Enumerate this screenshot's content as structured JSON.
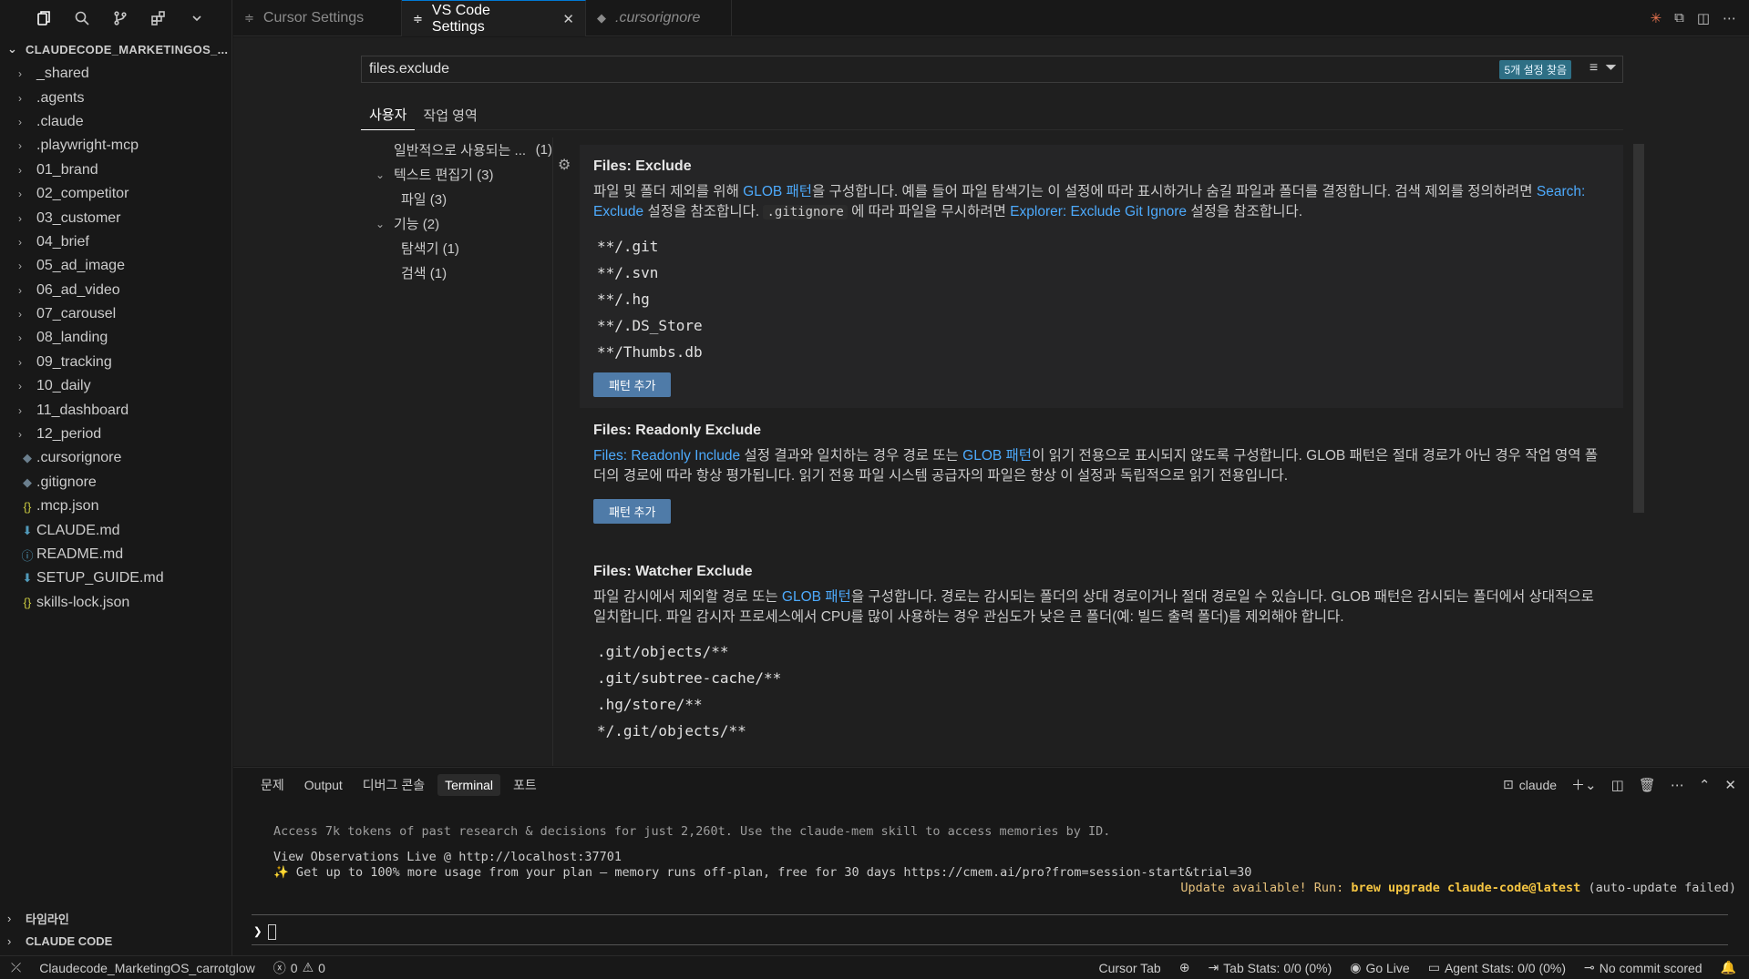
{
  "explorer": {
    "title": "CLAUDECODE_MARKETINGOS_...",
    "items": [
      {
        "label": "_shared",
        "type": "folder"
      },
      {
        "label": ".agents",
        "type": "folder"
      },
      {
        "label": ".claude",
        "type": "folder"
      },
      {
        "label": ".playwright-mcp",
        "type": "folder"
      },
      {
        "label": "01_brand",
        "type": "folder"
      },
      {
        "label": "02_competitor",
        "type": "folder"
      },
      {
        "label": "03_customer",
        "type": "folder"
      },
      {
        "label": "04_brief",
        "type": "folder"
      },
      {
        "label": "05_ad_image",
        "type": "folder"
      },
      {
        "label": "06_ad_video",
        "type": "folder"
      },
      {
        "label": "07_carousel",
        "type": "folder"
      },
      {
        "label": "08_landing",
        "type": "folder"
      },
      {
        "label": "09_tracking",
        "type": "folder"
      },
      {
        "label": "10_daily",
        "type": "folder"
      },
      {
        "label": "11_dashboard",
        "type": "folder"
      },
      {
        "label": "12_period",
        "type": "folder"
      },
      {
        "label": ".cursorignore",
        "type": "file",
        "icon": "diamond"
      },
      {
        "label": ".gitignore",
        "type": "file",
        "icon": "diamond"
      },
      {
        "label": ".mcp.json",
        "type": "file",
        "icon": "braces"
      },
      {
        "label": "CLAUDE.md",
        "type": "file",
        "icon": "markdown"
      },
      {
        "label": "README.md",
        "type": "file",
        "icon": "info"
      },
      {
        "label": "SETUP_GUIDE.md",
        "type": "file",
        "icon": "markdown"
      },
      {
        "label": "skills-lock.json",
        "type": "file",
        "icon": "braces"
      }
    ],
    "timeline_label": "타임라인",
    "claude_code_label": "CLAUDE CODE"
  },
  "tabs": [
    {
      "label": "Cursor Settings",
      "active": false,
      "icon": "settings-tab-icon"
    },
    {
      "label": "VS Code Settings",
      "active": true,
      "icon": "settings-tab-icon"
    },
    {
      "label": ".cursorignore",
      "active": false,
      "icon": "file-icon"
    }
  ],
  "settings": {
    "search_value": "files.exclude",
    "result_count": "5개 설정 찾음",
    "scope_tabs": [
      "사용자",
      "작업 영역"
    ],
    "toc": [
      {
        "label": "일반적으로 사용되는 ...",
        "count": "(1)"
      },
      {
        "label": "텍스트 편집기 (3)"
      },
      {
        "label": "파일 (3)"
      },
      {
        "label": "기능 (2)"
      },
      {
        "label": "탐색기 (1)"
      },
      {
        "label": "검색 (1)"
      }
    ],
    "exclude": {
      "title": "Files: Exclude",
      "desc_1": "파일 및 폴더 제외를 위해 ",
      "desc_link_1": "GLOB 패턴",
      "desc_2": "을 구성합니다. 예를 들어 파일 탐색기는 이 설정에 따라 표시하거나 숨길 파일과 폴더를 결정합니다. 검색 제외를 정의하려면 ",
      "desc_link_2": "Search: Exclude",
      "desc_3": " 설정을 참조합니다. ",
      "desc_code": ".gitignore",
      "desc_4": " 에 따라 파일을 무시하려면 ",
      "desc_link_3": "Explorer: Exclude Git Ignore",
      "desc_5": " 설정을 참조합니다.",
      "patterns": [
        "**/.git",
        "**/.svn",
        "**/.hg",
        "**/.DS_Store",
        "**/Thumbs.db"
      ],
      "add_label": "패턴 추가"
    },
    "readonly": {
      "title": "Files: Readonly Exclude",
      "desc_link_1": "Files: Readonly Include",
      "desc_1": " 설정 결과와 일치하는 경우 경로 또는 ",
      "desc_link_2": "GLOB 패턴",
      "desc_2": "이 읽기 전용으로 표시되지 않도록 구성합니다. GLOB 패턴은 절대 경로가 아닌 경우 작업 영역 폴더의 경로에 따라 항상 평가됩니다. 읽기 전용 파일 시스템 공급자의 파일은 항상 이 설정과 독립적으로 읽기 전용입니다.",
      "add_label": "패턴 추가"
    },
    "watcher": {
      "title": "Files: Watcher Exclude",
      "desc_1": "파일 감시에서 제외할 경로 또는 ",
      "desc_link_1": "GLOB 패턴",
      "desc_2": "을 구성합니다. 경로는 감시되는 폴더의 상대 경로이거나 절대 경로일 수 있습니다. GLOB 패턴은 감시되는 폴더에서 상대적으로 일치합니다. 파일 감시자 프로세스에서 CPU를 많이 사용하는 경우 관심도가 낮은 큰 폴더(예: 빌드 출력 폴더)를 제외해야 합니다.",
      "patterns": [
        ".git/objects/**",
        ".git/subtree-cache/**",
        ".hg/store/**",
        "*/.git/objects/**"
      ]
    }
  },
  "panel": {
    "tabs": [
      "문제",
      "Output",
      "디버그 콘솔",
      "Terminal",
      "포트"
    ],
    "active_tab": "Terminal",
    "terminal_name": "claude",
    "lines": {
      "l1": "Access 7k tokens of past research & decisions for just 2,260t. Use the claude-mem skill to access memories by ID.",
      "l2": "View Observations Live @ http://localhost:37701",
      "l3": "✨ Get up to 100% more usage from your plan — memory runs off-plan, free for 30 days https://cmem.ai/pro?from=session-start&trial=30",
      "update_prefix": "Update available! Run: ",
      "update_cmd": "brew upgrade claude-code@latest",
      "update_suffix": " (auto-update failed)"
    },
    "prompt": "❯"
  },
  "status_bar": {
    "remote": "Claudecode_MarketingOS_carrotglow",
    "errors": "0",
    "warnings": "0",
    "cursor_tab": "Cursor Tab",
    "tab_stats": "Tab Stats: 0/0 (0%)",
    "go_live": "Go Live",
    "agent_stats": "Agent Stats: 0/0 (0%)",
    "commit": "No commit scored"
  },
  "colors": {
    "accent": "#0078d4",
    "link": "#4daafc",
    "button": "#4f7ba8",
    "badge": "#2e6f85",
    "update": "#f5c542"
  }
}
